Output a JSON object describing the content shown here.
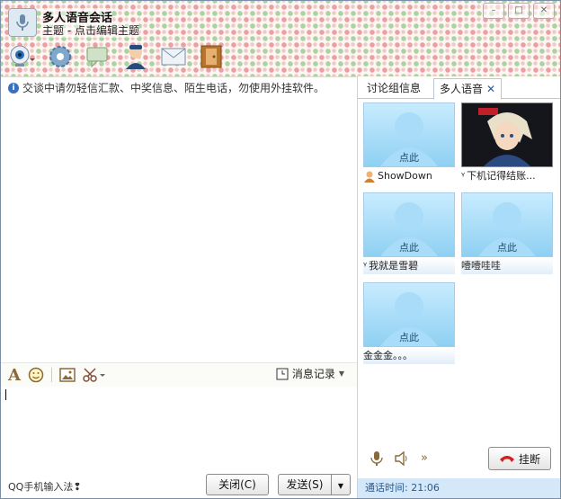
{
  "window": {
    "title": "多人语音会话",
    "subtitle": "主题 - 点击编辑主题",
    "controls": [
      "minimize-icon",
      "maximize-icon",
      "close-icon"
    ]
  },
  "toolbar": {
    "icons": [
      "camera-icon",
      "settings-icon",
      "chat-icon",
      "user-icon",
      "mail-icon",
      "exit-icon"
    ]
  },
  "notice": {
    "icon": "info-icon",
    "text": "交谈中请勿轻信汇款、中奖信息、陌生电话，勿使用外挂软件。"
  },
  "format_bar": {
    "icons": [
      "font-icon",
      "emoji-icon",
      "image-icon",
      "scissors-icon"
    ],
    "history_label": "消息记录"
  },
  "bottom": {
    "ime_label": "QQ手机输入法",
    "close_label": "关闭(C)",
    "send_label": "发送(S)"
  },
  "side": {
    "tabs": [
      {
        "label": "讨论组信息"
      },
      {
        "label": "多人语音",
        "active": true
      }
    ],
    "click_label": "点此",
    "participants": [
      {
        "name": "ShowDown",
        "prefix_icon": "user-status-icon"
      },
      {
        "name": "下机记得结账...",
        "prefix": "ᵞ"
      },
      {
        "name": "我就是雪碧",
        "prefix": "ᵞ"
      },
      {
        "name": "噎噎哇哇"
      },
      {
        "name": "金金金。。。"
      }
    ],
    "hangup_label": "挂断",
    "call_time": "通话时间: 21:06"
  },
  "colors": {
    "accent": "#2a5a9a",
    "avatar_bg": "#8fd0f2",
    "time_bar": "#d4e8fa"
  }
}
